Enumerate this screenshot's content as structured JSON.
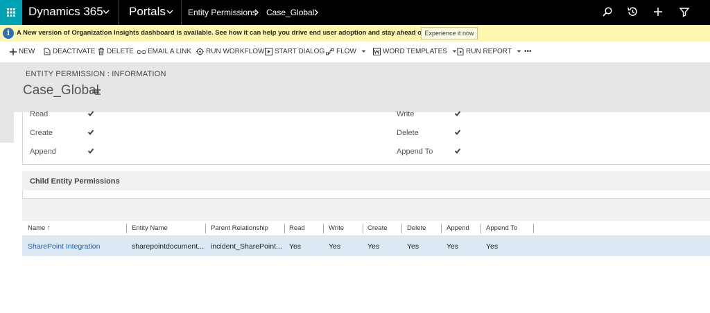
{
  "topnav": {
    "app_title": "Dynamics 365",
    "area_title": "Portals",
    "breadcrumb": [
      "Entity Permissions",
      "Case_Global"
    ]
  },
  "banner": {
    "message": "A New version of Organization Insights dashboard is available. See how it can help you drive end user adoption and stay ahead of support issues.",
    "button_label": "Experience it now"
  },
  "commands": {
    "new": "NEW",
    "deactivate": "DEACTIVATE",
    "delete": "DELETE",
    "email_link": "EMAIL A LINK",
    "run_workflow": "RUN WORKFLOW",
    "start_dialog": "START DIALOG",
    "flow": "FLOW",
    "word_templates": "WORD TEMPLATES",
    "run_report": "RUN REPORT",
    "more": "•••"
  },
  "header": {
    "entity_label": "ENTITY PERMISSION : INFORMATION",
    "record_title": "Case_Global"
  },
  "permissions": {
    "read": "Read",
    "write": "Write",
    "create": "Create",
    "delete": "Delete",
    "append": "Append",
    "append_to": "Append To"
  },
  "child_section": {
    "title": "Child Entity Permissions",
    "columns": [
      "Name ↑",
      "Entity Name",
      "Parent Relationship",
      "Read",
      "Write",
      "Create",
      "Delete",
      "Append",
      "Append To"
    ],
    "rows": [
      {
        "name": "SharePoint Integration",
        "entity_name": "sharepointdocument...",
        "parent_relationship": "incident_SharePoint...",
        "read": "Yes",
        "write": "Yes",
        "create": "Yes",
        "delete": "Yes",
        "append": "Yes",
        "append_to": "Yes"
      }
    ]
  },
  "colors": {
    "waffle": "#00a3b4",
    "nav_bg": "#000000",
    "banner_bg": "#fff7b0",
    "header_bg": "#e6e6e6",
    "selected_row": "#dce9f5",
    "link": "#1f5fa8"
  }
}
